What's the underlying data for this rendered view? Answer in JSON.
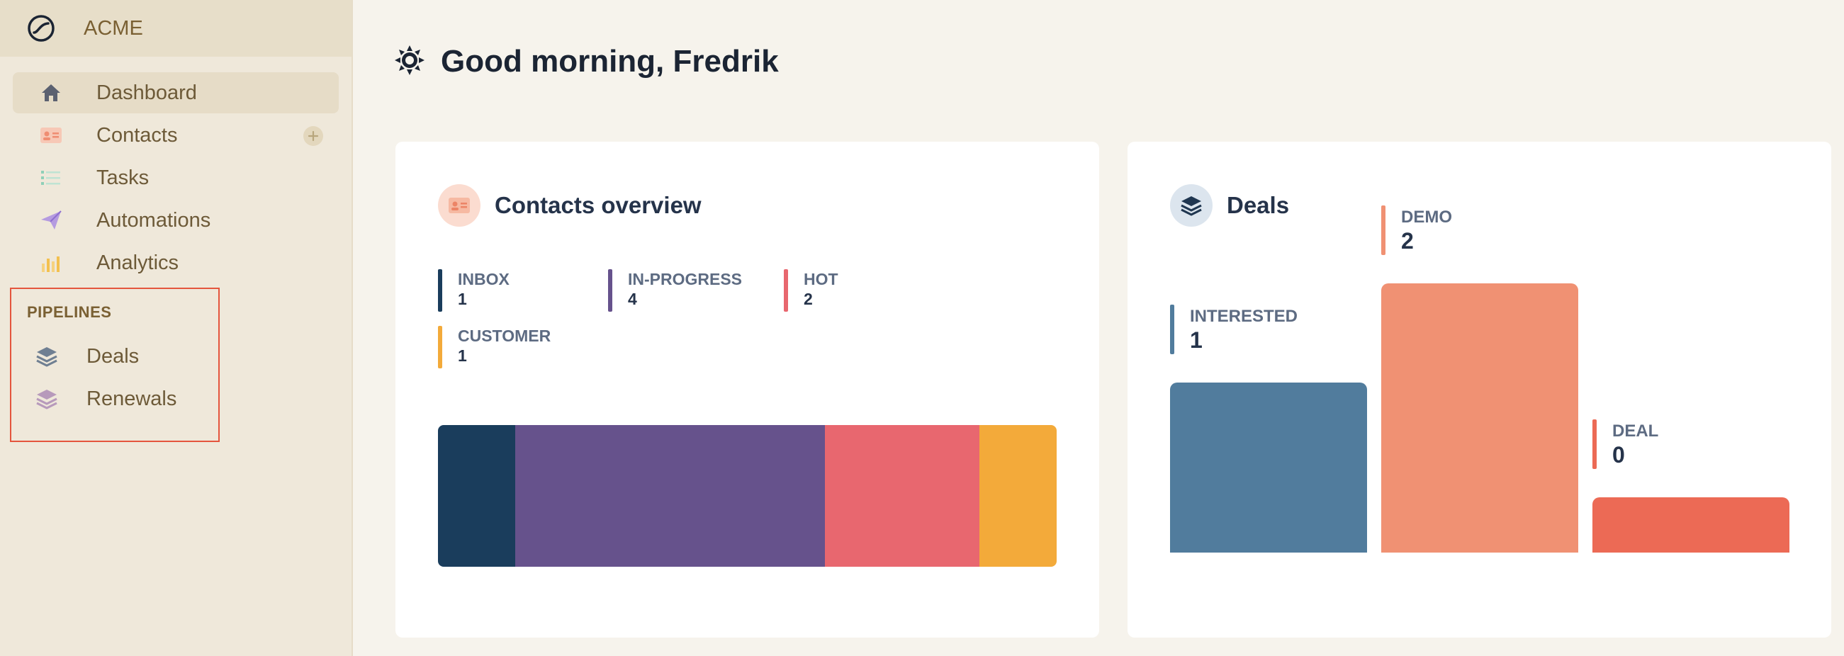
{
  "brand": {
    "name": "ACME",
    "logo_icon": "leaf-circle-icon"
  },
  "nav": [
    {
      "label": "Dashboard",
      "icon": "home-icon",
      "active": true
    },
    {
      "label": "Contacts",
      "icon": "contact-card-icon",
      "active": false
    },
    {
      "label": "Tasks",
      "icon": "list-icon",
      "active": false
    },
    {
      "label": "Automations",
      "icon": "paper-plane-icon",
      "active": false
    },
    {
      "label": "Analytics",
      "icon": "bar-chart-icon",
      "active": false
    }
  ],
  "pipelines": {
    "title": "PIPELINES",
    "items": [
      {
        "label": "Deals",
        "icon": "layers-icon"
      },
      {
        "label": "Renewals",
        "icon": "layers-icon"
      }
    ]
  },
  "greeting": {
    "text": "Good morning, Fredrik",
    "icon": "sun-icon"
  },
  "contacts_overview": {
    "title": "Contacts overview",
    "icon": "contact-card-icon",
    "segments": [
      {
        "label": "INBOX",
        "value": "1",
        "color": "#1a3d5c"
      },
      {
        "label": "IN-PROGRESS",
        "value": "4",
        "color": "#66528c"
      },
      {
        "label": "HOT",
        "value": "2",
        "color": "#e8676f"
      },
      {
        "label": "CUSTOMER",
        "value": "1",
        "color": "#f3aa3a"
      }
    ]
  },
  "deals": {
    "title": "Deals",
    "icon": "layers-icon",
    "stages": [
      {
        "label": "INTERESTED",
        "value": "1",
        "color": "#517c9d"
      },
      {
        "label": "DEMO",
        "value": "2",
        "color": "#f09173"
      },
      {
        "label": "DEAL",
        "value": "0",
        "color": "#ec6a55"
      }
    ]
  }
}
